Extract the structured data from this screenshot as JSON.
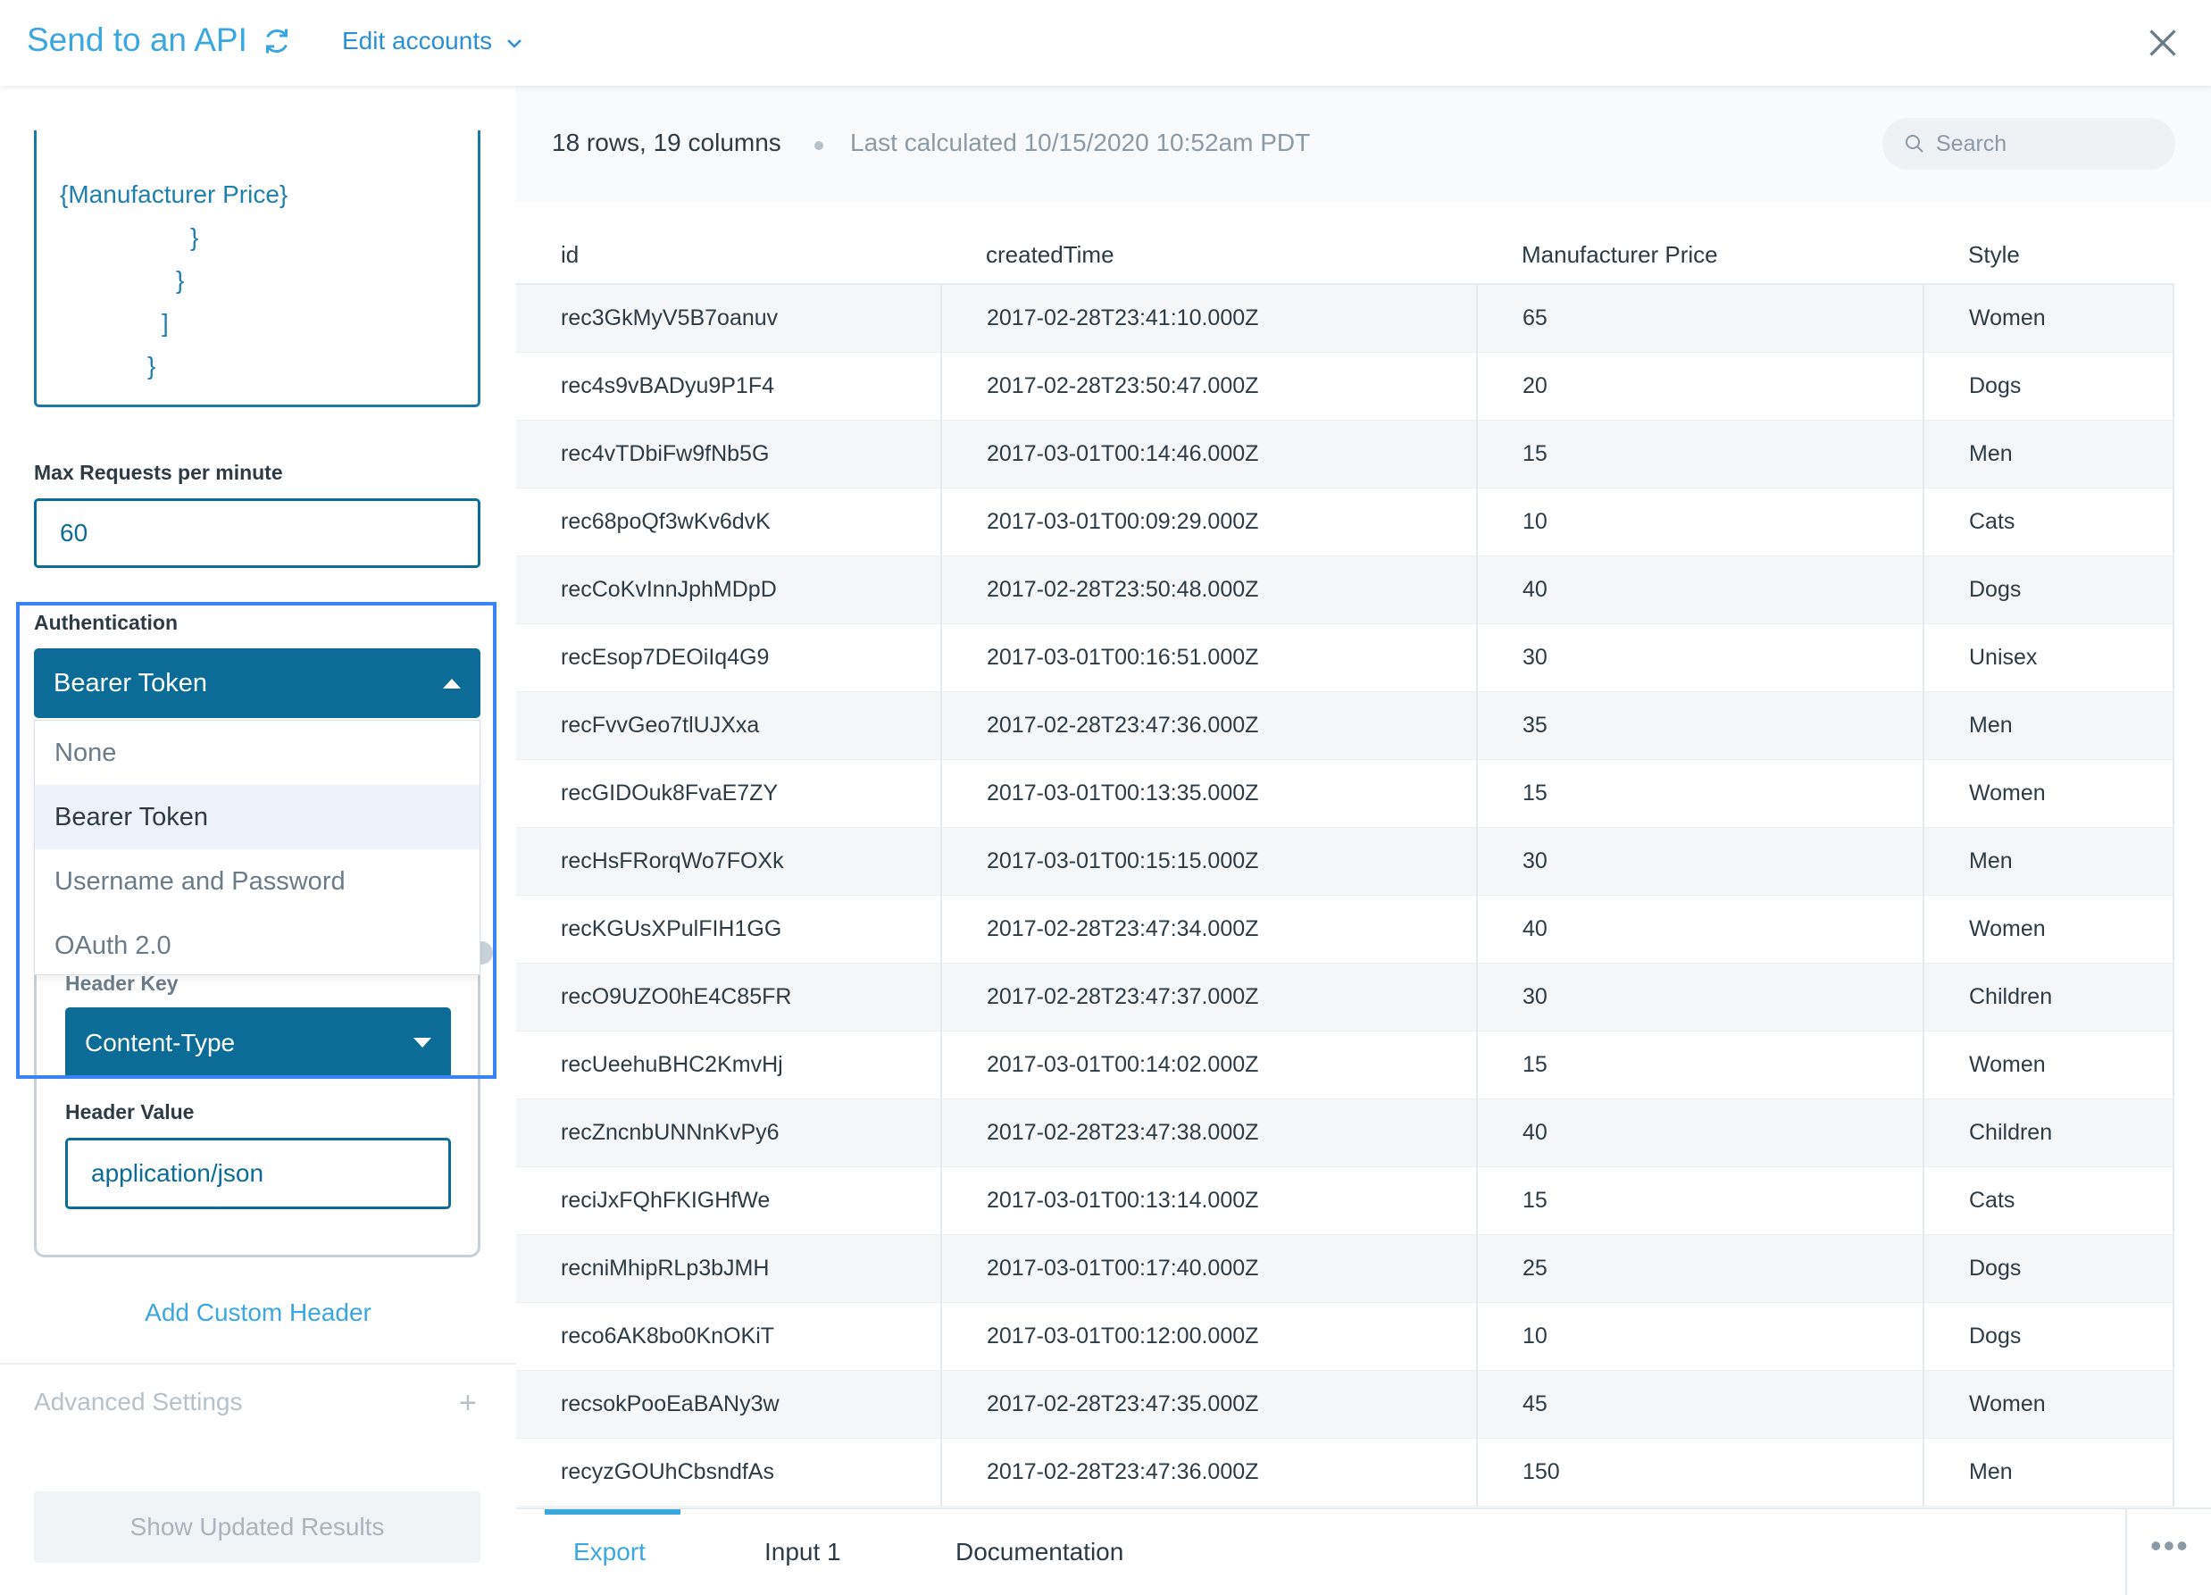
{
  "header": {
    "title": "Send to an API",
    "edit_accounts": "Edit accounts",
    "chevron": "⌄"
  },
  "left": {
    "code_lines": [
      "{Manufacturer Price}",
      "}",
      "}",
      "]",
      "}"
    ],
    "max_requests_label": "Max Requests per minute",
    "max_requests_value": "60",
    "auth_label": "Authentication",
    "auth_selected": "Bearer Token",
    "auth_options": [
      "None",
      "Bearer Token",
      "Username and Password",
      "OAuth 2.0"
    ],
    "header_key_label": "Header Key",
    "header_key_value": "Content-Type",
    "header_value_label": "Header Value",
    "header_value_value": "application/json",
    "add_custom_header": "Add Custom Header",
    "advanced_settings": "Advanced Settings",
    "plus": "+",
    "show_updated": "Show Updated Results"
  },
  "right": {
    "rows_cols": "18 rows, 19 columns",
    "last_calculated": "Last calculated 10/15/2020 10:52am PDT",
    "search_placeholder": "Search",
    "columns": [
      "id",
      "createdTime",
      "Manufacturer Price",
      "Style"
    ],
    "rows": [
      [
        "rec3GkMyV5B7oanuv",
        "2017-02-28T23:41:10.000Z",
        "65",
        "Women"
      ],
      [
        "rec4s9vBADyu9P1F4",
        "2017-02-28T23:50:47.000Z",
        "20",
        "Dogs"
      ],
      [
        "rec4vTDbiFw9fNb5G",
        "2017-03-01T00:14:46.000Z",
        "15",
        "Men"
      ],
      [
        "rec68poQf3wKv6dvK",
        "2017-03-01T00:09:29.000Z",
        "10",
        "Cats"
      ],
      [
        "recCoKvInnJphMDpD",
        "2017-02-28T23:50:48.000Z",
        "40",
        "Dogs"
      ],
      [
        "recEsop7DEOiIq4G9",
        "2017-03-01T00:16:51.000Z",
        "30",
        "Unisex"
      ],
      [
        "recFvvGeo7tlUJXxa",
        "2017-02-28T23:47:36.000Z",
        "35",
        "Men"
      ],
      [
        "recGIDOuk8FvaE7ZY",
        "2017-03-01T00:13:35.000Z",
        "15",
        "Women"
      ],
      [
        "recHsFRorqWo7FOXk",
        "2017-03-01T00:15:15.000Z",
        "30",
        "Men"
      ],
      [
        "recKGUsXPulFIH1GG",
        "2017-02-28T23:47:34.000Z",
        "40",
        "Women"
      ],
      [
        "recO9UZO0hE4C85FR",
        "2017-02-28T23:47:37.000Z",
        "30",
        "Children"
      ],
      [
        "recUeehuBHC2KmvHj",
        "2017-03-01T00:14:02.000Z",
        "15",
        "Women"
      ],
      [
        "recZncnbUNNnKvPy6",
        "2017-02-28T23:47:38.000Z",
        "40",
        "Children"
      ],
      [
        "reciJxFQhFKIGHfWe",
        "2017-03-01T00:13:14.000Z",
        "15",
        "Cats"
      ],
      [
        "recniMhipRLp3bJMH",
        "2017-03-01T00:17:40.000Z",
        "25",
        "Dogs"
      ],
      [
        "reco6AK8bo0KnOKiT",
        "2017-03-01T00:12:00.000Z",
        "10",
        "Dogs"
      ],
      [
        "recsokPooEaBANy3w",
        "2017-02-28T23:47:35.000Z",
        "45",
        "Women"
      ],
      [
        "recyzGOUhCbsndfAs",
        "2017-02-28T23:47:36.000Z",
        "150",
        "Men"
      ]
    ],
    "tabs": [
      "Export",
      "Input 1",
      "Documentation"
    ],
    "more": "•••"
  },
  "icons": {
    "refresh": "refresh-icon",
    "close": "close-icon",
    "search": "search-icon",
    "caret": "caret-icon",
    "more": "more-icon"
  },
  "colors": {
    "accent": "#3aa7e0",
    "primary_dark": "#0b6d97",
    "highlight": "#3b82f6"
  }
}
